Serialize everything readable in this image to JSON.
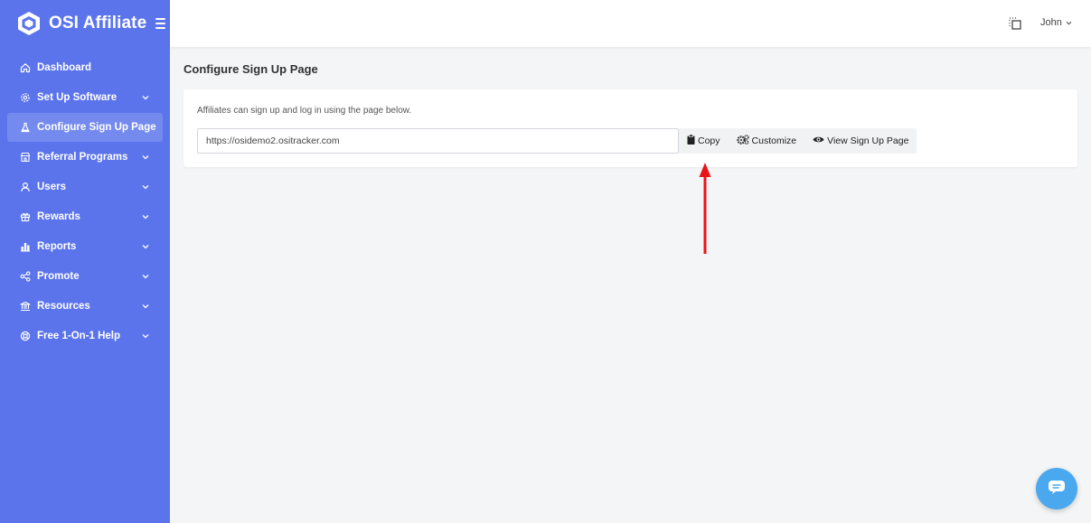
{
  "brand": {
    "name": "OSI Affiliate"
  },
  "sidebar": {
    "items": [
      {
        "label": "Dashboard",
        "icon": "home-icon",
        "has_children": false,
        "active": false
      },
      {
        "label": "Set Up Software",
        "icon": "cog-icon",
        "has_children": true,
        "active": false
      },
      {
        "label": "Configure Sign Up Page",
        "icon": "flask-icon",
        "has_children": false,
        "active": true
      },
      {
        "label": "Referral Programs",
        "icon": "store-icon",
        "has_children": true,
        "active": false
      },
      {
        "label": "Users",
        "icon": "user-icon",
        "has_children": true,
        "active": false
      },
      {
        "label": "Rewards",
        "icon": "gift-icon",
        "has_children": true,
        "active": false
      },
      {
        "label": "Reports",
        "icon": "bar-chart-icon",
        "has_children": true,
        "active": false
      },
      {
        "label": "Promote",
        "icon": "share-icon",
        "has_children": true,
        "active": false
      },
      {
        "label": "Resources",
        "icon": "library-icon",
        "has_children": true,
        "active": false
      },
      {
        "label": "Free 1-On-1 Help",
        "icon": "lifebuoy-icon",
        "has_children": true,
        "active": false
      }
    ]
  },
  "topbar": {
    "user_name": "John"
  },
  "main": {
    "page_title": "Configure Sign Up Page",
    "description": "Affiliates can sign up and log in using the page below.",
    "signup_url": "https://osidemo2.ositracker.com",
    "buttons": {
      "copy": "Copy",
      "customize": "Customize",
      "view": "View Sign Up Page"
    }
  },
  "colors": {
    "sidebar_bg": "#5b74ec",
    "annotation_arrow": "#e8141a",
    "chat_button": "#4aa8ef"
  }
}
